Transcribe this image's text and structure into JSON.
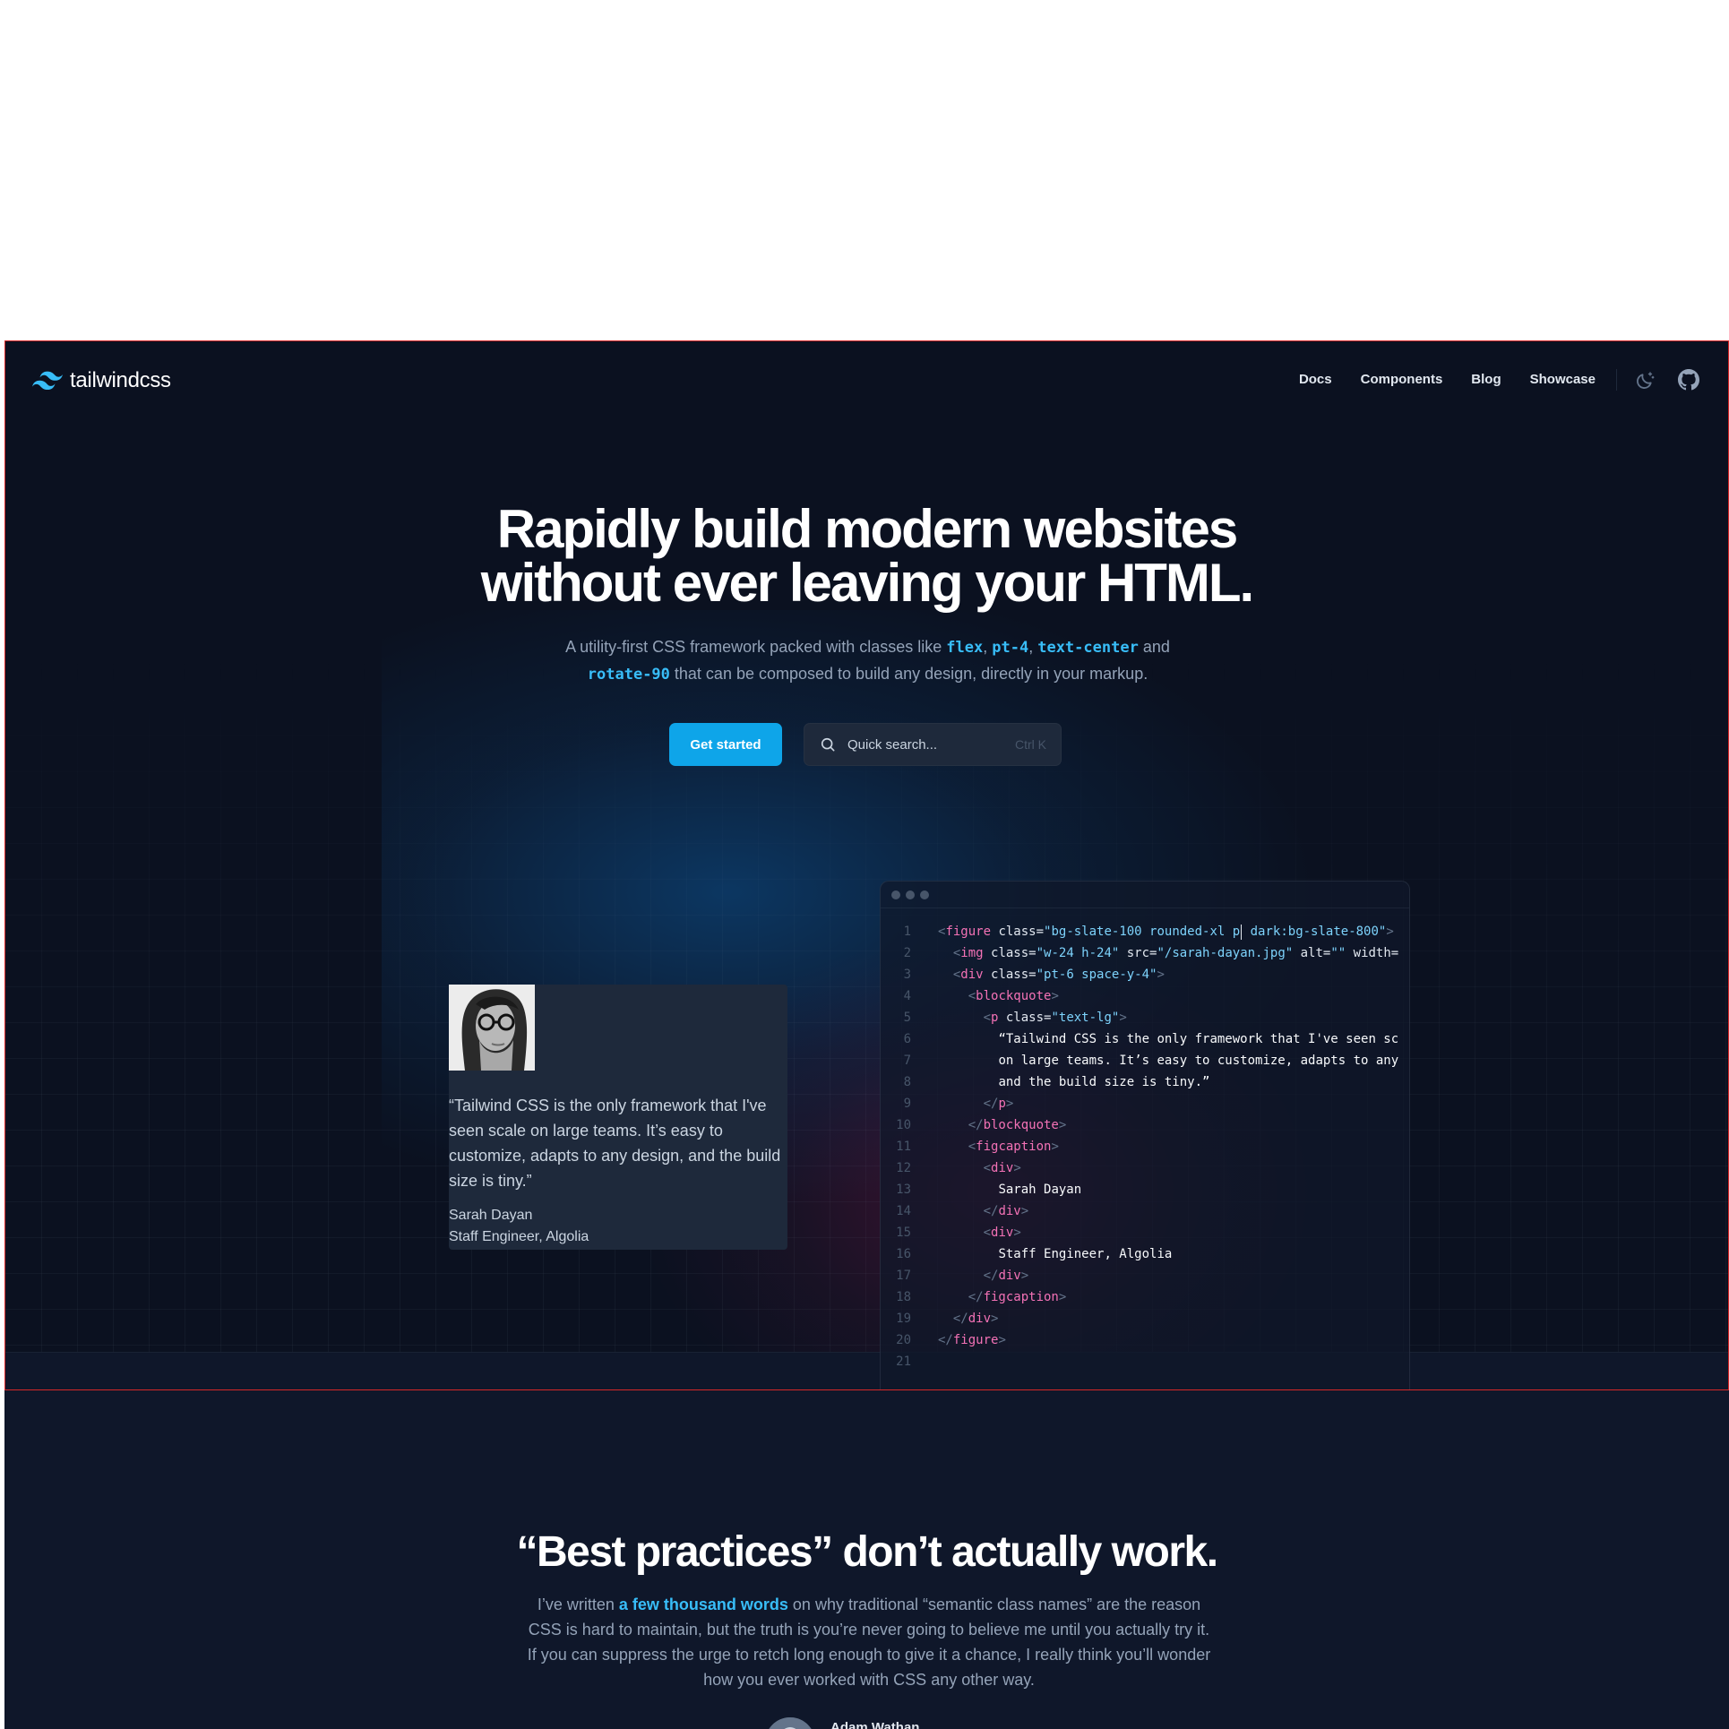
{
  "nav": {
    "logo_text": "tailwindcss",
    "links": [
      "Docs",
      "Components",
      "Blog",
      "Showcase"
    ],
    "theme_icon": "moon-sparkle-icon",
    "github_icon": "github-icon"
  },
  "hero": {
    "headline_line1": "Rapidly build modern websites",
    "headline_line2": "without ever leaving your HTML.",
    "sub_part1": "A utility-first CSS framework packed with classes like ",
    "kw1": "flex",
    "sep1": ", ",
    "kw2": "pt-4",
    "sep2": ", ",
    "kw3": "text-center",
    "sub_part2": " and",
    "kw4": "rotate-90",
    "sub_part3": " that can be composed to build any design, directly in your markup.",
    "cta_label": "Get started",
    "search_placeholder": "Quick search...",
    "search_shortcut": "Ctrl K"
  },
  "testimonial": {
    "quote": "“Tailwind CSS is the only framework that I've seen scale on large teams. It’s easy to customize, adapts to any design, and the build size is tiny.”",
    "name": "Sarah Dayan",
    "role": "Staff Engineer, Algolia"
  },
  "code": {
    "line_numbers": [
      "1",
      "2",
      "3",
      "4",
      "5",
      "6",
      "7",
      "8",
      "9",
      "10",
      "11",
      "12",
      "13",
      "14",
      "15",
      "16",
      "17",
      "18",
      "19",
      "20",
      "21"
    ],
    "l1_attr": " class=",
    "l1_str_a": "\"bg-slate-100 rounded-xl p",
    "l1_str_b": " dark:bg-slate-800\"",
    "l2_attr_class": " class=",
    "l2_str_class": "\"w-24 h-24\"",
    "l2_attr_src": " src=",
    "l2_str_src": "\"/sarah-dayan.jpg\"",
    "l2_attr_alt": " alt=",
    "l2_str_alt": "\"\"",
    "l2_attr_width": " width=",
    "l3_attr": " class=",
    "l3_str": "\"pt-6 space-y-4\"",
    "l5_attr": " class=",
    "l5_str": "\"text-lg\"",
    "l6_text": "“Tailwind CSS is the only framework that I've seen sc",
    "l7_text": "on large teams. It’s easy to customize, adapts to any",
    "l8_text": "and the build size is tiny.”",
    "l13_text": "Sarah Dayan",
    "l16_text": "Staff Engineer, Algolia",
    "tags": {
      "figure": "figure",
      "img": "img",
      "div": "div",
      "blockquote": "blockquote",
      "p": "p",
      "figcaption": "figcaption"
    }
  },
  "section2": {
    "title": "“Best practices” don’t actually work.",
    "body_part1": "I’ve written ",
    "link": "a few thousand words",
    "body_part2": " on why traditional “semantic class names” are the reason CSS is hard to maintain, but the truth is you’re never going to believe me until you actually try it. If you can suppress the urge to retch long enough to give it a chance, I really think you’ll wonder how you ever worked with CSS any other way.",
    "author_name": "Adam Wathan"
  },
  "colors": {
    "accent": "#38bdf8",
    "primary_button": "#0ea5e9",
    "background": "#0f172a",
    "code_tag": "#f472b6"
  }
}
